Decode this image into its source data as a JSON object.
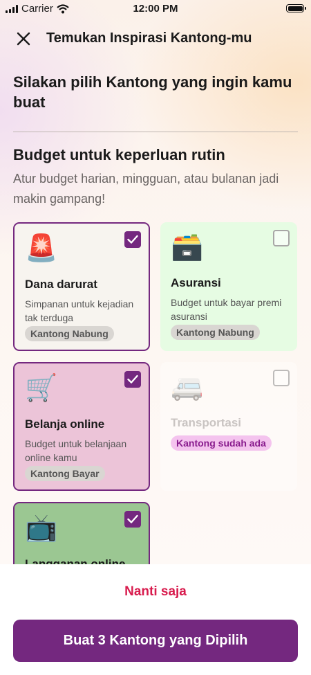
{
  "status_bar": {
    "carrier": "Carrier",
    "time": "12:00 PM"
  },
  "header": {
    "title": "Temukan Inspirasi Kantong-mu"
  },
  "intro": "Silakan pilih Kantong yang ingin kamu buat",
  "section": {
    "title": "Budget untuk keperluan rutin",
    "description": "Atur budget harian, mingguan, atau bulanan jadi makin gampang!"
  },
  "cards": [
    {
      "emoji": "🚨",
      "title": "Dana darurat",
      "description": "Simpanan untuk kejadian tak terduga",
      "tag": "Kantong Nabung",
      "selected": true,
      "background": "#f7f4ef"
    },
    {
      "emoji": "🗃️",
      "title": "Asuransi",
      "description": "Budget untuk bayar premi asuransi",
      "tag": "Kantong Nabung",
      "selected": false,
      "background": "#e6fce3"
    },
    {
      "emoji": "🛒",
      "title": "Belanja online",
      "description": "Budget untuk belanjaan online kamu",
      "tag": "Kantong Bayar",
      "selected": true,
      "background": "#ecc4d8"
    },
    {
      "emoji": "🚐",
      "title": "Transportasi",
      "tag": "Kantong sudah ada",
      "selected": false,
      "disabled": true
    },
    {
      "emoji": "📺",
      "title": "Langganan online",
      "selected": true,
      "background": "#9bc792"
    }
  ],
  "actions": {
    "later": "Nanti saja",
    "create": "Buat 3 Kantong yang Dipilih"
  },
  "colors": {
    "accent": "#74287f",
    "later_text": "#d81b4d",
    "existing_tag_bg": "#f4c3ee",
    "existing_tag_text": "#8a1c8e"
  }
}
